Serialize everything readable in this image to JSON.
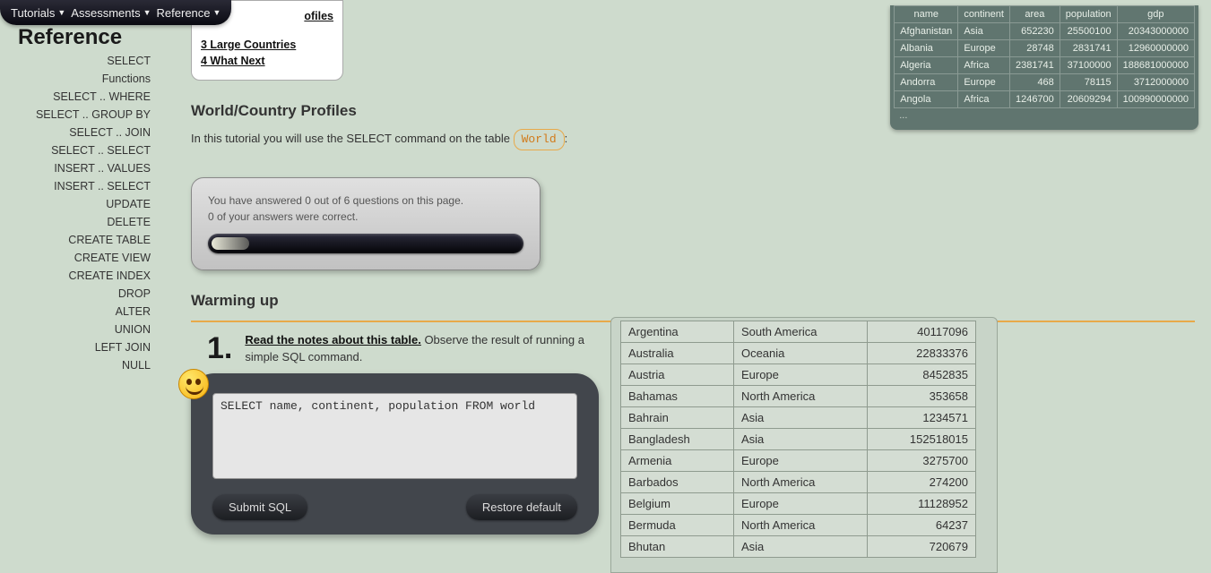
{
  "topnav": {
    "items": [
      "Tutorials",
      "Assessments",
      "Reference"
    ]
  },
  "page_title": "Reference",
  "sidebar": {
    "items": [
      "SELECT",
      "Functions",
      "SELECT .. WHERE",
      "SELECT .. GROUP BY",
      "SELECT .. JOIN",
      "SELECT .. SELECT",
      "INSERT .. VALUES",
      "INSERT .. SELECT",
      "UPDATE",
      "DELETE",
      "CREATE TABLE",
      "CREATE VIEW",
      "CREATE INDEX",
      "DROP",
      "ALTER",
      "UNION",
      "LEFT JOIN",
      "NULL"
    ]
  },
  "toc": {
    "items": [
      "ofiles",
      "3 Large Countries",
      "4 What Next"
    ]
  },
  "section1": {
    "heading": "World/Country Profiles",
    "intro_pre": "In this tutorial you will use the SELECT command on the table ",
    "pill": "World",
    "intro_post": ":"
  },
  "score": {
    "line1": "You have answered 0 out of 6 questions on this page.",
    "line2": "0 of your answers were correct."
  },
  "section2": {
    "heading": "Warming up"
  },
  "question": {
    "num": "1.",
    "link": "Read the notes about this table.",
    "rest": " Observe the result of running a simple SQL command."
  },
  "sql": {
    "value": "SELECT name, continent, population FROM world",
    "submit": "Submit SQL",
    "restore": "Restore default"
  },
  "ref_table": {
    "headers": [
      "name",
      "continent",
      "area",
      "population",
      "gdp"
    ],
    "rows": [
      [
        "Afghanistan",
        "Asia",
        "652230",
        "25500100",
        "20343000000"
      ],
      [
        "Albania",
        "Europe",
        "28748",
        "2831741",
        "12960000000"
      ],
      [
        "Algeria",
        "Africa",
        "2381741",
        "37100000",
        "188681000000"
      ],
      [
        "Andorra",
        "Europe",
        "468",
        "78115",
        "3712000000"
      ],
      [
        "Angola",
        "Africa",
        "1246700",
        "20609294",
        "100990000000"
      ]
    ],
    "ellipsis": "..."
  },
  "results": {
    "rows": [
      [
        "Argentina",
        "South America",
        "40117096"
      ],
      [
        "Australia",
        "Oceania",
        "22833376"
      ],
      [
        "Austria",
        "Europe",
        "8452835"
      ],
      [
        "Bahamas",
        "North America",
        "353658"
      ],
      [
        "Bahrain",
        "Asia",
        "1234571"
      ],
      [
        "Bangladesh",
        "Asia",
        "152518015"
      ],
      [
        "Armenia",
        "Europe",
        "3275700"
      ],
      [
        "Barbados",
        "North America",
        "274200"
      ],
      [
        "Belgium",
        "Europe",
        "11128952"
      ],
      [
        "Bermuda",
        "North America",
        "64237"
      ],
      [
        "Bhutan",
        "Asia",
        "720679"
      ]
    ]
  }
}
